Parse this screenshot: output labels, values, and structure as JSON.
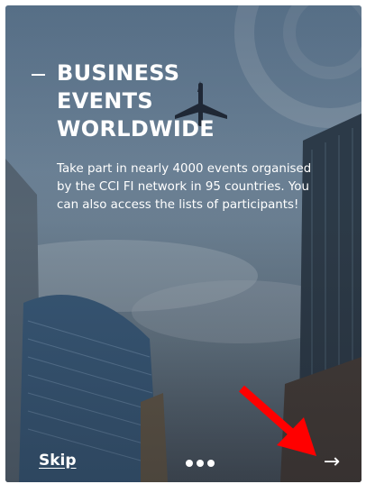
{
  "slide": {
    "title_lines": [
      "BUSINESS",
      "EVENTS",
      "WORLDWIDE"
    ],
    "description": "Take part in nearly 4000 events organised by the CCI FI network in 95 countries.  You can also access the lists of participants!"
  },
  "footer": {
    "skip_label": "Skip",
    "next_icon": "→",
    "pagination_count": 3
  },
  "icons": {
    "airplane": "airplane-icon",
    "arrow": "arrow-right-icon",
    "annotation": "red-arrow-icon"
  },
  "colors": {
    "text": "#ffffff",
    "annotation_arrow": "#ff0000"
  }
}
